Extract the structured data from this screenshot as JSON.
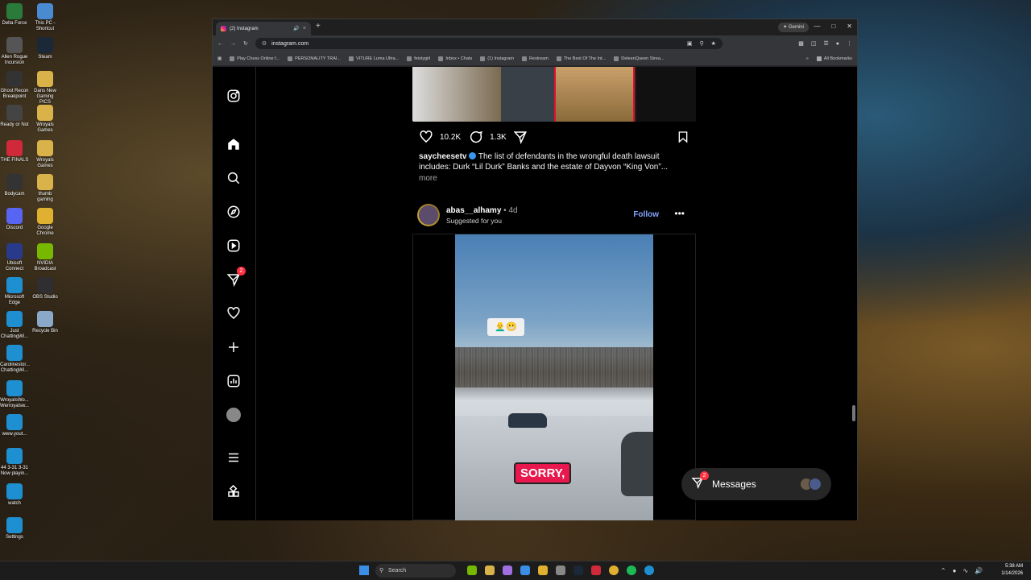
{
  "desktop": {
    "icons": [
      {
        "label": "Delta Force",
        "color": "#2a7a3a"
      },
      {
        "label": "This PC - Shortcut",
        "color": "#4a8ad0"
      },
      {
        "label": "Allen Rogue Incursion",
        "color": "#555"
      },
      {
        "label": "Steam",
        "color": "#1b2838"
      },
      {
        "label": "Ghost Recon Breakpoint",
        "color": "#333"
      },
      {
        "label": "Dans New Gaming PICS",
        "color": "#d9b24a"
      },
      {
        "label": "Ready or Not",
        "color": "#444"
      },
      {
        "label": "Wroyals Games",
        "color": "#d9b24a"
      },
      {
        "label": "THE FINALS",
        "color": "#d02a3a"
      },
      {
        "label": "Wroyals Games",
        "color": "#d9b24a"
      },
      {
        "label": "Bodycam",
        "color": "#333"
      },
      {
        "label": "thumb gaming",
        "color": "#d9b24a"
      },
      {
        "label": "Discord",
        "color": "#5865f2"
      },
      {
        "label": "Google Chrome",
        "color": "#e0b030"
      },
      {
        "label": "Ubisoft Connect",
        "color": "#2a3a8a"
      },
      {
        "label": "NVIDIA Broadcast",
        "color": "#76b900"
      },
      {
        "label": "Microsoft Edge",
        "color": "#1e8fd0"
      },
      {
        "label": "OBS Studio",
        "color": "#302e31"
      },
      {
        "label": "Just ChattingWi...",
        "color": "#1e8fd0"
      },
      {
        "label": "Recycle Bin",
        "color": "#8aa8c8"
      },
      {
        "label": "Carolinestor... ChattingWi...",
        "color": "#1e8fd0"
      },
      {
        "label": "WroyalsWo... Werroyalsw...",
        "color": "#1e8fd0"
      },
      {
        "label": "www.yout...",
        "color": "#1e8fd0"
      },
      {
        "label": "44 3-31 3-31 Now playin...",
        "color": "#1e8fd0"
      },
      {
        "label": "watch",
        "color": "#1e8fd0"
      },
      {
        "label": "Settings",
        "color": "#1e8fd0"
      }
    ]
  },
  "browser": {
    "tab_title": "(2) Instagram",
    "gemini_label": "Gemini",
    "url": "instagram.com",
    "bookmarks": [
      "Play Chess Online f...",
      "PERSONALITY TRAI...",
      "VITURE Luma Ultra...",
      "feistygirl",
      "Inbox • Chats",
      "(1) Instagram",
      "Restream",
      "The Best Of The Int...",
      "DeleenQueen Strea..."
    ],
    "all_bookmarks": "All Bookmarks"
  },
  "instagram": {
    "nav_badge": "2",
    "post1": {
      "likes": "10.2K",
      "comments": "1.3K",
      "username": "saycheesetv",
      "caption": "The list of defendants in the wrongful death lawsuit includes: Durk “Lil Durk” Banks and the estate of Dayvon “King Von”...",
      "more": "more"
    },
    "post2": {
      "username": "abas__alhamy",
      "age": "4d",
      "separator": " • ",
      "suggested": "Suggested for you",
      "follow": "Follow",
      "emoji_tag": "👨‍🦲😬",
      "caption_overlay": "SORRY,"
    },
    "messages": {
      "label": "Messages",
      "badge": "2"
    }
  },
  "taskbar": {
    "search_placeholder": "Search",
    "time": "5:38 AM",
    "date": "1/14/2026"
  }
}
